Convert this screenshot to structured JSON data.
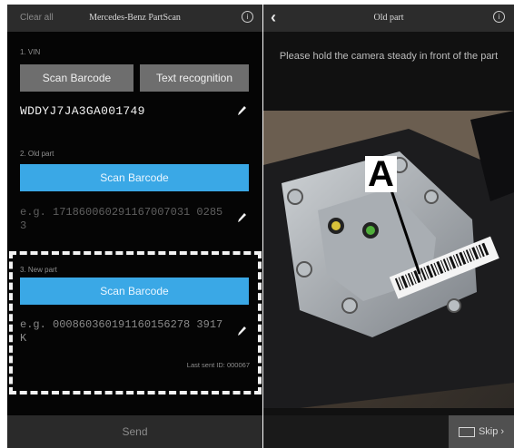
{
  "left": {
    "topbar": {
      "clear_all": "Clear all",
      "title": "Mercedes-Benz PartScan",
      "info": "ⓘ"
    },
    "vin": {
      "label": "1. VIN",
      "scan_barcode": "Scan Barcode",
      "text_recognition": "Text recognition",
      "value": "WDDYJ7JA3GA001749"
    },
    "old_part": {
      "label": "2. Old part",
      "scan_barcode": "Scan Barcode",
      "placeholder": "e.g. 171860060291167007031 02853"
    },
    "new_part": {
      "label": "3. New part",
      "scan_barcode": "Scan Barcode",
      "placeholder": "e.g. 000860360191160156278 3917K",
      "last_sent": "Last sent ID: 000067"
    },
    "send": "Send"
  },
  "right": {
    "topbar": {
      "back": "‹",
      "title": "Old part",
      "info": "ⓘ"
    },
    "hint": "Please hold the camera steady in front of the part",
    "annotation": "A",
    "skip": "Skip ›"
  }
}
